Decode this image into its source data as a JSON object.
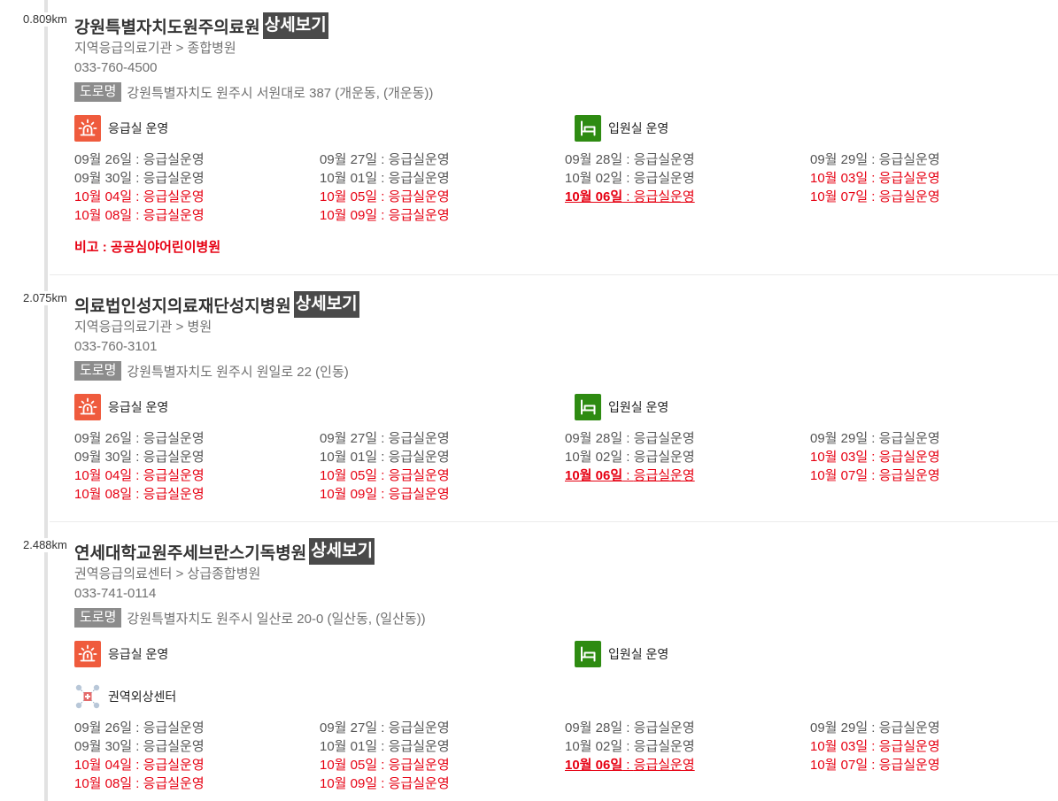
{
  "colors": {
    "red": "#e60012",
    "date_gray": "#555555",
    "meta_gray": "#707070",
    "title": "#333333",
    "detail_badge": "#4a4a4a",
    "road_badge": "#8c8c8c",
    "er_icon": "#ef5b3d",
    "ward_icon": "#2e8b12",
    "timeline": "#e2e2e2",
    "divider": "#ebebeb"
  },
  "icons": {
    "er": "siren-icon",
    "ward": "bed-icon"
  },
  "labels": {
    "detail": "상세보기",
    "road": "도로명",
    "category_sep": ">",
    "date_sep": " : "
  },
  "hospitals": [
    {
      "distance": "0.809km",
      "name": "강원특별자치도원주의료원",
      "level": "지역응급의료기관",
      "type": "종합병원",
      "phone": "033-760-4500",
      "address": "강원특별자치도 원주시 서원대로 387 (개운동, (개운동))",
      "er_status": "응급실 운영",
      "ward_status": "입원실 운영",
      "services": [],
      "schedule": [
        {
          "date": "09월 26일",
          "status": "응급실운영",
          "tone": "gray"
        },
        {
          "date": "09월 27일",
          "status": "응급실운영",
          "tone": "gray"
        },
        {
          "date": "09월 28일",
          "status": "응급실운영",
          "tone": "gray"
        },
        {
          "date": "09월 29일",
          "status": "응급실운영",
          "tone": "gray"
        },
        {
          "date": "09월 30일",
          "status": "응급실운영",
          "tone": "gray"
        },
        {
          "date": "10월 01일",
          "status": "응급실운영",
          "tone": "gray"
        },
        {
          "date": "10월 02일",
          "status": "응급실운영",
          "tone": "gray"
        },
        {
          "date": "10월 03일",
          "status": "응급실운영",
          "tone": "red"
        },
        {
          "date": "10월 04일",
          "status": "응급실운영",
          "tone": "red"
        },
        {
          "date": "10월 05일",
          "status": "응급실운영",
          "tone": "red"
        },
        {
          "date": "10월 06일",
          "status": "응급실운영",
          "tone": "red",
          "emphasis": true
        },
        {
          "date": "10월 07일",
          "status": "응급실운영",
          "tone": "red"
        },
        {
          "date": "10월 08일",
          "status": "응급실운영",
          "tone": "red"
        },
        {
          "date": "10월 09일",
          "status": "응급실운영",
          "tone": "red"
        }
      ],
      "note": "비고 : 공공심야어린이병원"
    },
    {
      "distance": "2.075km",
      "name": "의료법인성지의료재단성지병원",
      "level": "지역응급의료기관",
      "type": "병원",
      "phone": "033-760-3101",
      "address": "강원특별자치도 원주시 원일로 22 (인동)",
      "er_status": "응급실 운영",
      "ward_status": "입원실 운영",
      "services": [],
      "schedule": [
        {
          "date": "09월 26일",
          "status": "응급실운영",
          "tone": "gray"
        },
        {
          "date": "09월 27일",
          "status": "응급실운영",
          "tone": "gray"
        },
        {
          "date": "09월 28일",
          "status": "응급실운영",
          "tone": "gray"
        },
        {
          "date": "09월 29일",
          "status": "응급실운영",
          "tone": "gray"
        },
        {
          "date": "09월 30일",
          "status": "응급실운영",
          "tone": "gray"
        },
        {
          "date": "10월 01일",
          "status": "응급실운영",
          "tone": "gray"
        },
        {
          "date": "10월 02일",
          "status": "응급실운영",
          "tone": "gray"
        },
        {
          "date": "10월 03일",
          "status": "응급실운영",
          "tone": "red"
        },
        {
          "date": "10월 04일",
          "status": "응급실운영",
          "tone": "red"
        },
        {
          "date": "10월 05일",
          "status": "응급실운영",
          "tone": "red"
        },
        {
          "date": "10월 06일",
          "status": "응급실운영",
          "tone": "red",
          "emphasis": true
        },
        {
          "date": "10월 07일",
          "status": "응급실운영",
          "tone": "red"
        },
        {
          "date": "10월 08일",
          "status": "응급실운영",
          "tone": "red"
        },
        {
          "date": "10월 09일",
          "status": "응급실운영",
          "tone": "red"
        }
      ],
      "note": ""
    },
    {
      "distance": "2.488km",
      "name": "연세대학교원주세브란스기독병원",
      "level": "권역응급의료센터",
      "type": "상급종합병원",
      "phone": "033-741-0114",
      "address": "강원특별자치도 원주시 일산로 20-0 (일산동, (일산동))",
      "er_status": "응급실 운영",
      "ward_status": "입원실 운영",
      "services": [
        {
          "icon": "trauma-center-icon",
          "label": "권역외상센터"
        }
      ],
      "schedule": [
        {
          "date": "09월 26일",
          "status": "응급실운영",
          "tone": "gray"
        },
        {
          "date": "09월 27일",
          "status": "응급실운영",
          "tone": "gray"
        },
        {
          "date": "09월 28일",
          "status": "응급실운영",
          "tone": "gray"
        },
        {
          "date": "09월 29일",
          "status": "응급실운영",
          "tone": "gray"
        },
        {
          "date": "09월 30일",
          "status": "응급실운영",
          "tone": "gray"
        },
        {
          "date": "10월 01일",
          "status": "응급실운영",
          "tone": "gray"
        },
        {
          "date": "10월 02일",
          "status": "응급실운영",
          "tone": "gray"
        },
        {
          "date": "10월 03일",
          "status": "응급실운영",
          "tone": "red"
        },
        {
          "date": "10월 04일",
          "status": "응급실운영",
          "tone": "red"
        },
        {
          "date": "10월 05일",
          "status": "응급실운영",
          "tone": "red"
        },
        {
          "date": "10월 06일",
          "status": "응급실운영",
          "tone": "red",
          "emphasis": true
        },
        {
          "date": "10월 07일",
          "status": "응급실운영",
          "tone": "red"
        },
        {
          "date": "10월 08일",
          "status": "응급실운영",
          "tone": "red"
        },
        {
          "date": "10월 09일",
          "status": "응급실운영",
          "tone": "red"
        }
      ],
      "note": ""
    }
  ]
}
